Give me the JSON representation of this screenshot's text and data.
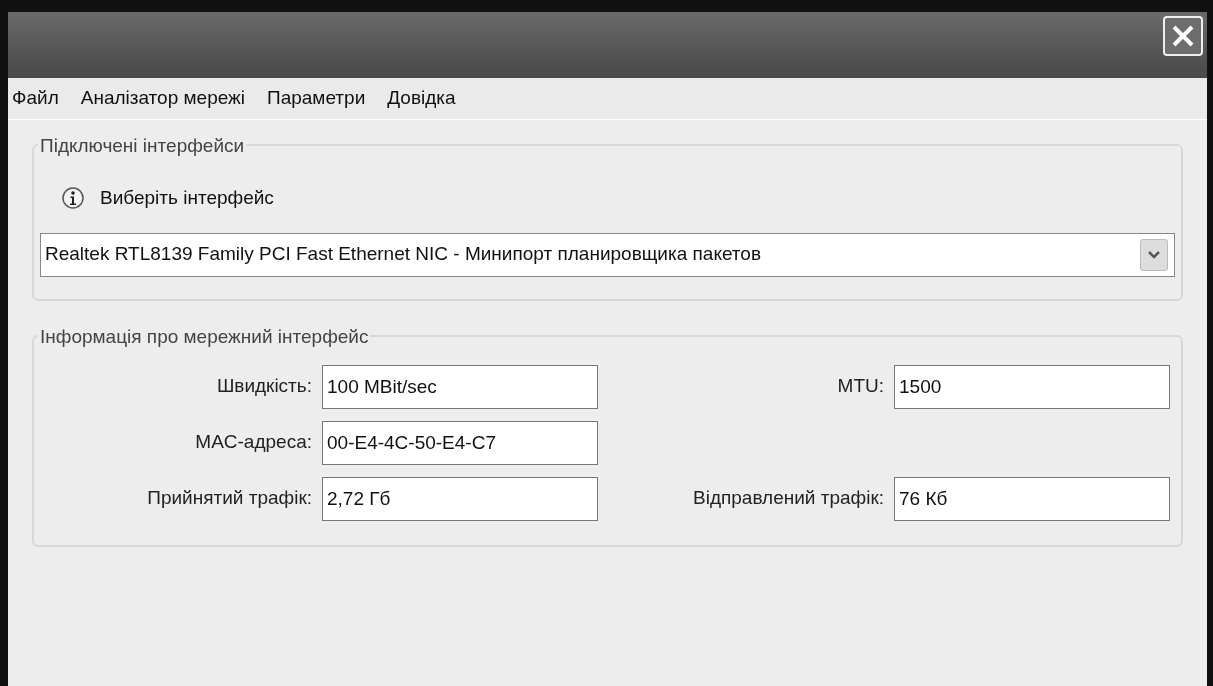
{
  "menu": [
    "Файл",
    "Аналізатор мережі",
    "Параметри",
    "Довідка"
  ],
  "interfaces_group": {
    "title": "Підключені інтерфейси",
    "hint": "Виберіть інтерфейс",
    "selected_interface": "Realtek RTL8139 Family PCI Fast Ethernet NIC - Минипорт планировщика пакетов"
  },
  "info_group": {
    "title": "Інформація про мережний інтерфейс",
    "rows": [
      {
        "fields": [
          {
            "label": "Швидкість:",
            "value": "100 MBit/sec"
          },
          {
            "label": "MTU:",
            "value": "1500"
          }
        ]
      },
      {
        "fields": [
          {
            "label": "MAC-адреса:",
            "value": "00-E4-4C-50-E4-C7"
          }
        ]
      },
      {
        "fields": [
          {
            "label": "Прийнятий трафік:",
            "value": "2,72 Гб"
          },
          {
            "label": "Відправлений трафік:",
            "value": "76 Кб"
          }
        ]
      }
    ]
  }
}
